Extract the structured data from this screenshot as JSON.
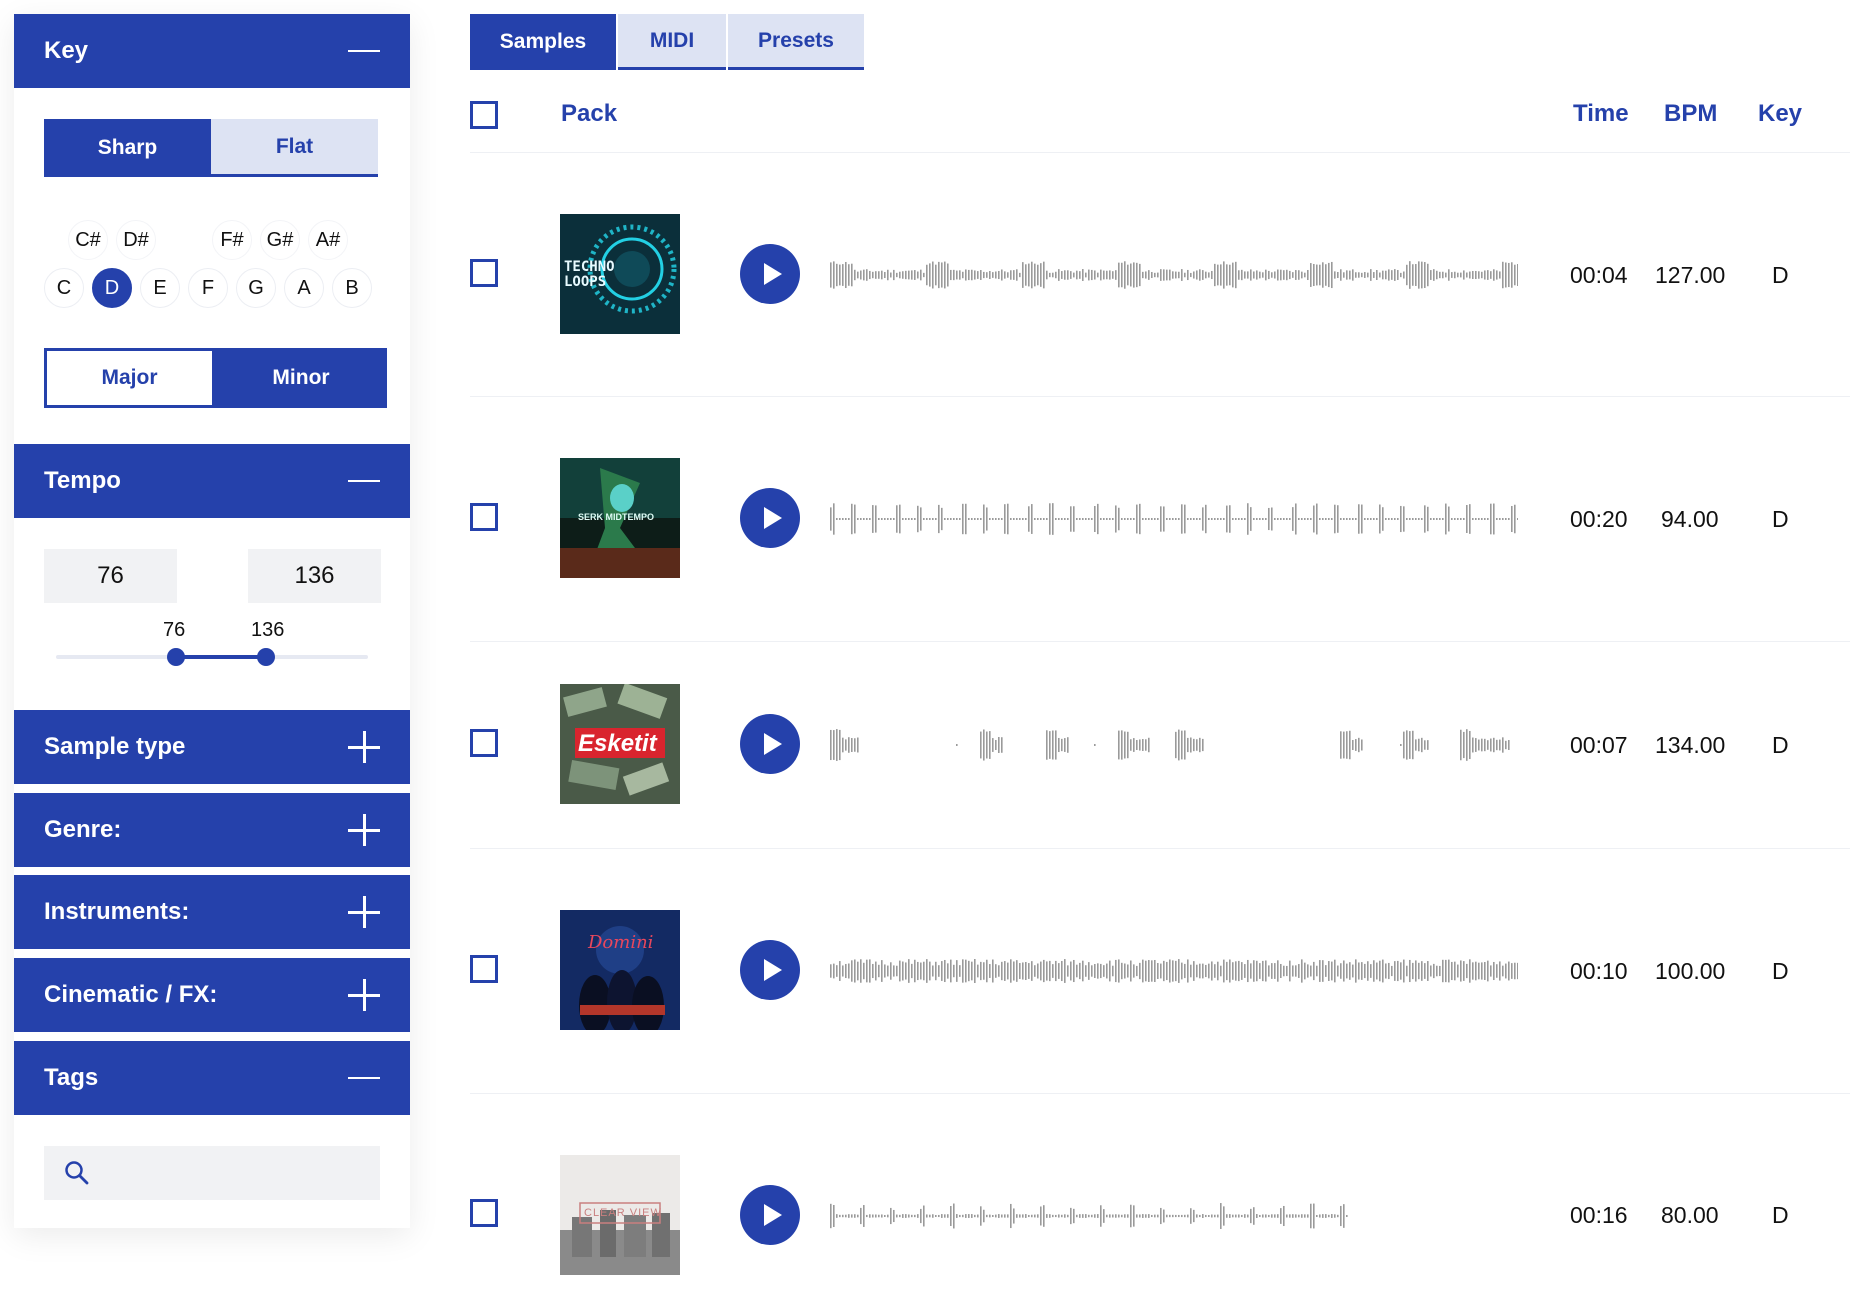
{
  "sidebar": {
    "key": {
      "title": "Key",
      "sharp_label": "Sharp",
      "flat_label": "Flat",
      "sharp_notes": [
        "C#",
        "D#",
        "F#",
        "G#",
        "A#"
      ],
      "natural_notes": [
        "C",
        "D",
        "E",
        "F",
        "G",
        "A",
        "B"
      ],
      "selected_note": "D",
      "major_label": "Major",
      "minor_label": "Minor"
    },
    "tempo": {
      "title": "Tempo",
      "min_value": "76",
      "max_value": "136",
      "slider_min_label": "76",
      "slider_max_label": "136"
    },
    "sample_type": {
      "title": "Sample type"
    },
    "genre": {
      "title": "Genre:"
    },
    "instruments": {
      "title": "Instruments:"
    },
    "cinematic": {
      "title": "Cinematic / FX:"
    },
    "tags": {
      "title": "Tags",
      "search_placeholder": ""
    }
  },
  "tabs": {
    "samples": "Samples",
    "midi": "MIDI",
    "presets": "Presets"
  },
  "table": {
    "headers": {
      "pack": "Pack",
      "time": "Time",
      "bpm": "BPM",
      "key": "Key"
    },
    "rows": [
      {
        "cover_text": "TECHNO LOOPS",
        "time": "00:04",
        "bpm": "127.00",
        "key": "D"
      },
      {
        "cover_text": "SERK MIDTEMPO",
        "time": "00:20",
        "bpm": "94.00",
        "key": "D"
      },
      {
        "cover_text": "Esketit",
        "time": "00:07",
        "bpm": "134.00",
        "key": "D"
      },
      {
        "cover_text": "Domini",
        "time": "00:10",
        "bpm": "100.00",
        "key": "D"
      },
      {
        "cover_text": "CLEAR VIEW",
        "time": "00:16",
        "bpm": "80.00",
        "key": "D"
      }
    ]
  },
  "colors": {
    "accent": "#2541ab",
    "accent_light": "#dde3f3",
    "field_bg": "#f1f2f4",
    "wave": "#9a9a9a"
  }
}
